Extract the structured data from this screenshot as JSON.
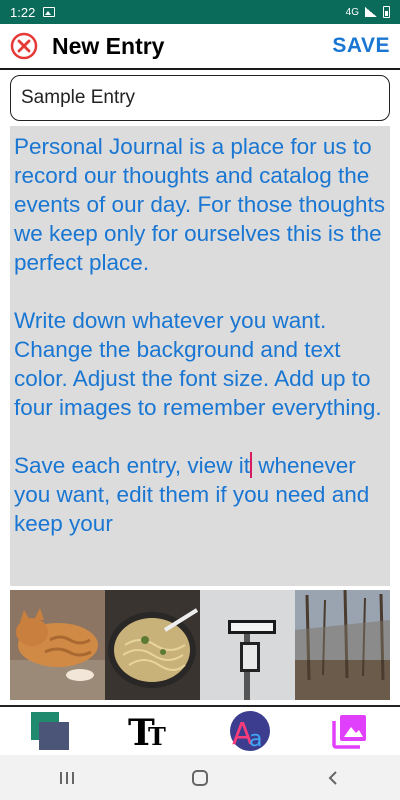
{
  "status_bar": {
    "time": "1:22",
    "network": "4G"
  },
  "header": {
    "title": "New Entry",
    "save_label": "SAVE",
    "close_icon": "close-circle-icon"
  },
  "entry": {
    "title_value": "Sample Entry",
    "body_paragraph_1": "Personal Journal is a place for us to record our thoughts and catalog the events of our day. For those thoughts we keep only for ourselves this is the perfect place.",
    "body_paragraph_2": "Write down whatever you want. Change the background and text color. Adjust the font size. Add up to four images to remember everything.",
    "body_paragraph_3_before_cursor": "Save each entry, view it",
    "body_paragraph_3_after_cursor": " whenever you want, edit them if you need and keep your"
  },
  "images": [
    {
      "name": "cat-photo"
    },
    {
      "name": "noodles-photo"
    },
    {
      "name": "one-way-sign-photo"
    },
    {
      "name": "forest-photo"
    }
  ],
  "toolbar": {
    "items": [
      {
        "name": "background-color-tool",
        "icon": "color-squares-icon"
      },
      {
        "name": "text-size-tool",
        "icon": "text-size-icon"
      },
      {
        "name": "text-color-tool",
        "icon": "font-color-icon"
      },
      {
        "name": "add-images-tool",
        "icon": "image-gallery-icon"
      }
    ]
  },
  "nav_bar": {
    "items": [
      "recents-icon",
      "home-icon",
      "back-icon"
    ]
  },
  "colors": {
    "status_bar": "#0b6b5a",
    "accent_blue": "#1976d2",
    "body_background": "#dcdcdc",
    "close_red": "#e53935",
    "cursor": "#d81b60"
  }
}
